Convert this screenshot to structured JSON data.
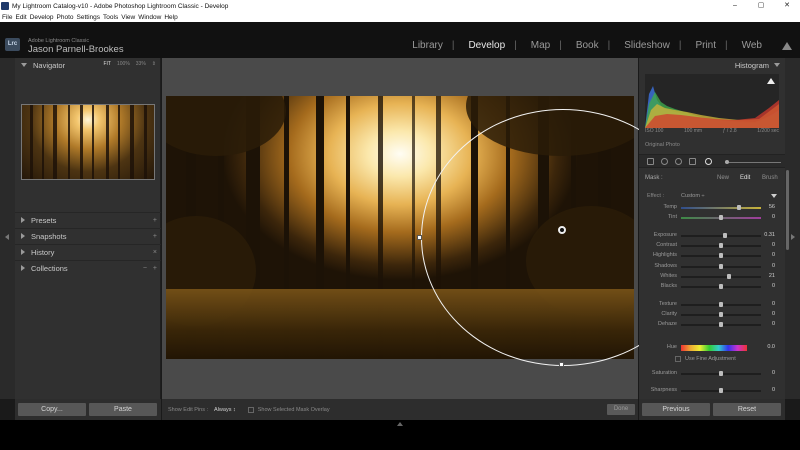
{
  "window": {
    "title": "My Lightroom Catalog-v10 - Adobe Photoshop Lightroom Classic - Develop",
    "controls": [
      "–",
      "▢",
      "✕"
    ]
  },
  "menu": [
    "File",
    "Edit",
    "Develop",
    "Photo",
    "Settings",
    "Tools",
    "View",
    "Window",
    "Help"
  ],
  "identity": {
    "logo": "Lrc",
    "app_small": "Adobe Lightroom Classic",
    "user_name": "Jason Parnell-Brookes"
  },
  "modules": [
    "Library",
    "Develop",
    "Map",
    "Book",
    "Slideshow",
    "Print",
    "Web"
  ],
  "active_module": "Develop",
  "left_panel": {
    "navigator": {
      "label": "Navigator",
      "zooms": [
        "FIT",
        "100%",
        "33%"
      ],
      "zoom_arrow": "⇕"
    },
    "sections": [
      {
        "label": "Presets",
        "action": "+"
      },
      {
        "label": "Snapshots",
        "action": "+"
      },
      {
        "label": "History",
        "action": "×"
      },
      {
        "label": "Collections",
        "action": "+",
        "action2": "−"
      }
    ],
    "copy_button": "Copy...",
    "paste_button": "Paste"
  },
  "toolbar": {
    "edit_pins_label": "Show Edit Pins :",
    "edit_pins_value": "Always ↕",
    "overlay_label": "Show Selected Mask Overlay",
    "done_button": "Done"
  },
  "right_panel": {
    "histogram": {
      "label": "Histogram",
      "iso": "ISO 100",
      "focal": "100 mm",
      "aperture": "ƒ / 2.8",
      "shutter": "1/200 sec",
      "original_photo": "Original Photo"
    },
    "mask": {
      "label": "Mask :",
      "options": [
        "New",
        "Edit",
        "Brush"
      ],
      "active": "Edit"
    },
    "effect": {
      "label": "Effect :",
      "value": "Custom ÷"
    },
    "sliders": [
      {
        "name": "Temp",
        "value": "56",
        "pos": 0.72,
        "style": "temp"
      },
      {
        "name": "Tint",
        "value": "0",
        "pos": 0.5,
        "style": "tint"
      },
      {
        "name": "Exposure",
        "value": "0.31",
        "pos": 0.55,
        "style": ""
      },
      {
        "name": "Contrast",
        "value": "0",
        "pos": 0.5,
        "style": ""
      },
      {
        "name": "Highlights",
        "value": "0",
        "pos": 0.5,
        "style": ""
      },
      {
        "name": "Shadows",
        "value": "0",
        "pos": 0.5,
        "style": ""
      },
      {
        "name": "Whites",
        "value": "21",
        "pos": 0.6,
        "style": ""
      },
      {
        "name": "Blacks",
        "value": "0",
        "pos": 0.5,
        "style": ""
      },
      {
        "name": "Texture",
        "value": "0",
        "pos": 0.5,
        "style": ""
      },
      {
        "name": "Clarity",
        "value": "0",
        "pos": 0.5,
        "style": ""
      },
      {
        "name": "Dehaze",
        "value": "0",
        "pos": 0.5,
        "style": ""
      }
    ],
    "hue": {
      "name": "Hue",
      "value": "0.0"
    },
    "fine_adjustment": "Use Fine Adjustment",
    "sliders_lower": [
      {
        "name": "Saturation",
        "value": "0",
        "pos": 0.5,
        "style": ""
      },
      {
        "name": "Sharpness",
        "value": "0",
        "pos": 0.5,
        "style": ""
      }
    ],
    "previous_button": "Previous",
    "reset_button": "Reset"
  },
  "colors": {
    "panel": "#303030",
    "image_bg": "#4a4a4a",
    "accent_warm": "#e7b354"
  }
}
